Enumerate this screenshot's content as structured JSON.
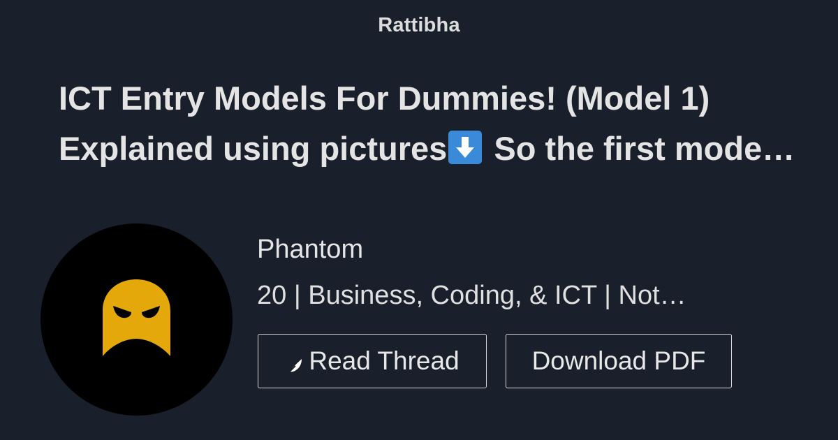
{
  "brand": "Rattibha",
  "thread": {
    "title_line1": "ICT Entry Models For Dummies! (Model 1)",
    "title_line2_before": "Explained using pictures",
    "title_line2_emoji": "down-arrow-emoji",
    "title_line2_after": " So the first mode…"
  },
  "author": {
    "name": "Phantom",
    "bio": "20 | Business, Coding, & ICT | Not…",
    "avatar_icon": "angry-ghost-avatar"
  },
  "actions": {
    "read_label": "Read Thread",
    "read_icon": "feather-icon",
    "download_label": "Download PDF"
  },
  "colors": {
    "background": "#19202b",
    "avatar_ghost": "#e4a80b",
    "emoji_blue": "#3b8ad9"
  }
}
